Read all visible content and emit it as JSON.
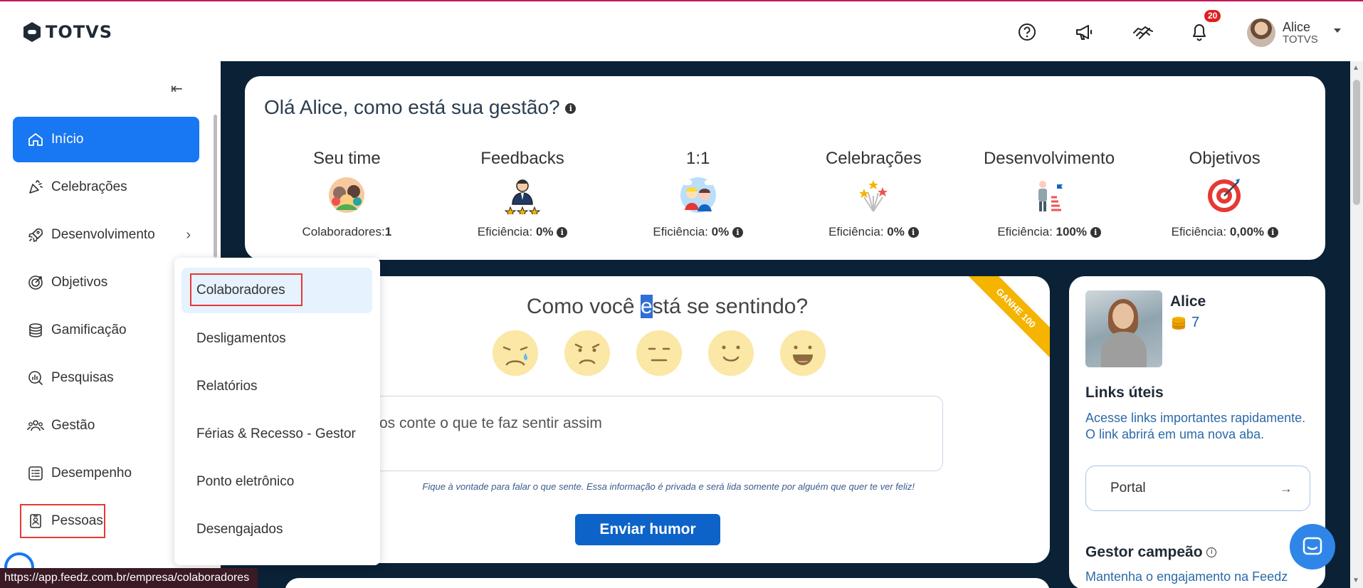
{
  "brand": {
    "name": "TOTVS"
  },
  "header": {
    "notifications_count": "20",
    "user": {
      "name": "Alice",
      "org": "TOTVS"
    }
  },
  "sidebar": {
    "items": [
      {
        "label": "Início",
        "icon": "home-icon",
        "active": true
      },
      {
        "label": "Celebrações",
        "icon": "party-icon"
      },
      {
        "label": "Desenvolvimento",
        "icon": "rocket-icon",
        "has_submenu": true
      },
      {
        "label": "Objetivos",
        "icon": "target-icon"
      },
      {
        "label": "Gamificação",
        "icon": "coins-icon"
      },
      {
        "label": "Pesquisas",
        "icon": "survey-icon"
      },
      {
        "label": "Gestão",
        "icon": "people-icon"
      },
      {
        "label": "Desempenho",
        "icon": "checklist-icon"
      },
      {
        "label": "Pessoas",
        "icon": "badge-icon"
      }
    ]
  },
  "submenu": {
    "items": [
      {
        "label": "Colaboradores"
      },
      {
        "label": "Desligamentos"
      },
      {
        "label": "Relatórios"
      },
      {
        "label": "Férias & Recesso - Gestor"
      },
      {
        "label": "Ponto eletrônico"
      },
      {
        "label": "Desengajados"
      }
    ]
  },
  "greeting": {
    "title": "Olá Alice, como está sua gestão?",
    "stats": [
      {
        "label": "Seu time",
        "value_prefix": "Colaboradores:",
        "value": "1"
      },
      {
        "label": "Feedbacks",
        "value_prefix": "Eficiência: ",
        "value": "0%"
      },
      {
        "label": "1:1",
        "value_prefix": "Eficiência: ",
        "value": "0%"
      },
      {
        "label": "Celebrações",
        "value_prefix": "Eficiência: ",
        "value": "0%"
      },
      {
        "label": "Desenvolvimento",
        "value_prefix": "Eficiência: ",
        "value": "100%"
      },
      {
        "label": "Objetivos",
        "value_prefix": "Eficiência: ",
        "value": "0,00%"
      }
    ]
  },
  "mood": {
    "title_before": "Como você ",
    "title_selected": "e",
    "title_after": "stá se sentindo?",
    "ribbon": "GANHE 100",
    "input_placeholder": "os conte o que te faz sentir assim",
    "note": "Fique à vontade para falar o que sente. Essa informação é privada e será lida somente por alguém que quer te ver feliz!",
    "send_label": "Enviar humor"
  },
  "profile": {
    "name": "Alice",
    "coins": "7",
    "links_title": "Links úteis",
    "links_desc": "Acesse links importantes rapidamente. O link abrirá em uma nova aba.",
    "portal_label": "Portal",
    "gestor_title": "Gestor campeão",
    "gestor_desc": "Mantenha o engajamento na Feedz"
  },
  "status_url": "https://app.feedz.com.br/empresa/colaboradores",
  "colors": {
    "accent": "#1877f2",
    "dark_bg": "#0a2136",
    "send_button": "#0d63c8",
    "highlight_box": "#e53935",
    "ribbon": "#f4b400"
  }
}
